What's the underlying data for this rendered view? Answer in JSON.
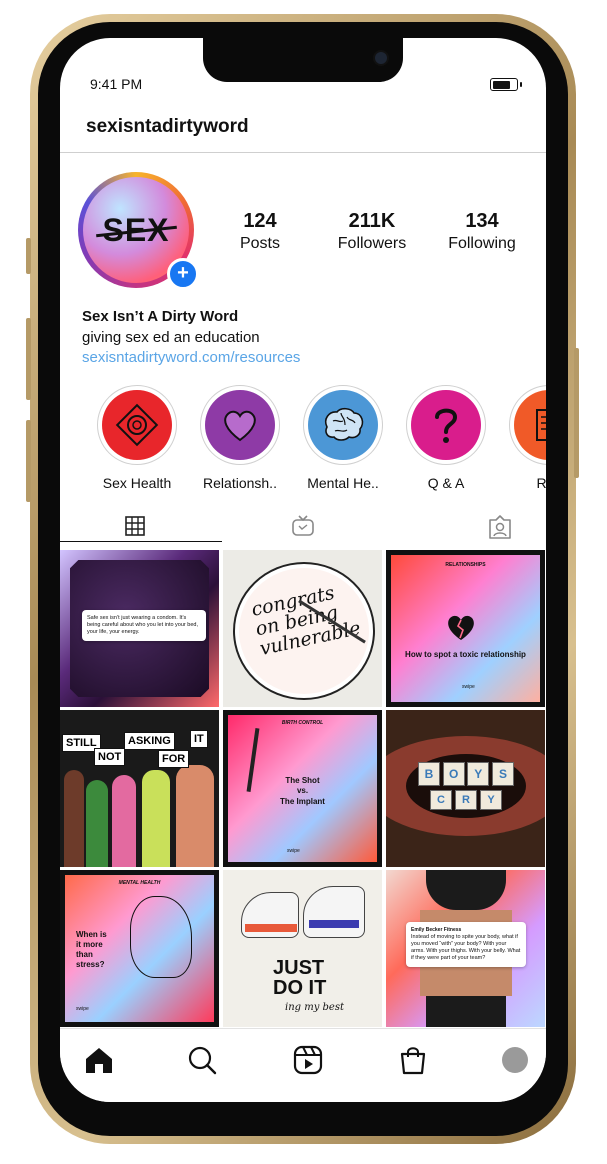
{
  "status_bar": {
    "time": "9:41 PM",
    "battery_level": 0.85
  },
  "header": {
    "username": "sexisntadirtyword"
  },
  "profile": {
    "avatar_text": "SEX",
    "add_badge": "+",
    "stats": [
      {
        "value": "124",
        "label": "Posts"
      },
      {
        "value": "211K",
        "label": "Followers"
      },
      {
        "value": "134",
        "label": "Following"
      }
    ],
    "bio": {
      "name": "Sex Isn’t A Dirty Word",
      "tagline": "giving sex ed an education",
      "link": "sexisntadirtyword.com/resources"
    }
  },
  "highlights": [
    {
      "label": "Sex Health",
      "color": "#e8262b",
      "icon": "condom-icon"
    },
    {
      "label": "Relationsh..",
      "color": "#8e3aa6",
      "icon": "heart-icon"
    },
    {
      "label": "Mental He..",
      "color": "#4c97d6",
      "icon": "brain-icon"
    },
    {
      "label": "Q & A",
      "color": "#d91d8c",
      "icon": "question-icon"
    },
    {
      "label": "Res",
      "color": "#f05a28",
      "icon": "resources-icon"
    }
  ],
  "tabs": [
    "grid-tab",
    "igtv-tab",
    "tagged-tab"
  ],
  "posts": {
    "p1": {
      "tweet": "Safe sex isn’t just wearing a condom. It’s being careful about who you let into your bed, your life, your energy."
    },
    "p2": {
      "line1": "congrats",
      "line2": "on being",
      "line3": "vulnerable"
    },
    "p3": {
      "category": "RELATIONSHIPS",
      "title": "How to spot a toxic relationship",
      "footer": "swipe"
    },
    "p4": {
      "signs": [
        "STILL",
        "NOT",
        "ASKING",
        "FOR",
        "IT"
      ]
    },
    "p5": {
      "category": "BIRTH CONTROL",
      "line1": "The Shot",
      "line2": "vs.",
      "line3": "The Implant",
      "footer": "swipe"
    },
    "p6": {
      "teeth": [
        "B",
        "O",
        "Y",
        "S",
        "C",
        "R",
        "Y"
      ]
    },
    "p7": {
      "category": "MENTAL HEALTH",
      "line1": "When is",
      "line2": "it more",
      "line3": "than",
      "line4": "stress?",
      "footer": "swipe"
    },
    "p8": {
      "line1": "JUST",
      "line2": "DO IT",
      "line3": "ing my best"
    },
    "p9": {
      "author": "Emily Becker Fitness",
      "tweet": "Instead of moving to spite your body, what if you moved “with” your body? With your arms. With your thighs. With your belly. What if they were part of your team?"
    }
  },
  "nav": [
    "home-icon",
    "search-icon",
    "reels-icon",
    "shop-icon",
    "profile-icon"
  ]
}
